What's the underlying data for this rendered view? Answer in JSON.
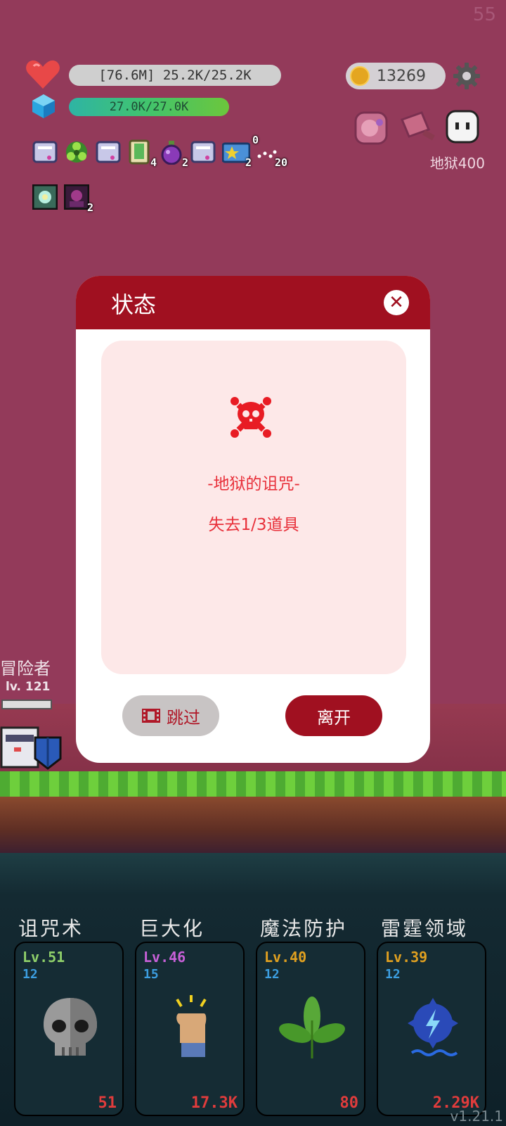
{
  "fps": "55",
  "hud": {
    "hp_text": "[76.6M] 25.2K/25.2K",
    "mp_text": "27.0K/27.0K",
    "coins": "13269",
    "hell_level": "地狱400"
  },
  "buffs_row1": [
    {
      "icon": "scroll-icon",
      "count": ""
    },
    {
      "icon": "biohazard-icon",
      "count": ""
    },
    {
      "icon": "scroll-icon",
      "count": ""
    },
    {
      "icon": "book-icon",
      "count": "4"
    },
    {
      "icon": "potion-icon",
      "count": "2"
    },
    {
      "icon": "scroll-icon",
      "count": ""
    },
    {
      "icon": "star-card-icon",
      "count": "2"
    }
  ],
  "buff_extra": {
    "top": "0",
    "bottom": "20"
  },
  "buffs_row2": [
    {
      "icon": "ghost-portrait-icon",
      "count": ""
    },
    {
      "icon": "demon-portrait-icon",
      "count": "2"
    }
  ],
  "modal": {
    "title": "状态",
    "curse_title": "-地狱的诅咒-",
    "curse_desc": "失去1/3道具",
    "skip_label": "跳过",
    "leave_label": "离开"
  },
  "adventurer": {
    "name": "冒险者",
    "level": "lv. 121"
  },
  "skills": [
    {
      "name": "诅咒术",
      "level": "Lv.51",
      "sub": "12",
      "cost": "51",
      "level_color": "#8fd06a",
      "icon": "skull-icon"
    },
    {
      "name": "巨大化",
      "level": "Lv.46",
      "sub": "15",
      "cost": "17.3K",
      "level_color": "#c860d8",
      "icon": "fist-icon"
    },
    {
      "name": "魔法防护",
      "level": "Lv.40",
      "sub": "12",
      "cost": "80",
      "level_color": "#e0a020",
      "icon": "leaf-icon"
    },
    {
      "name": "雷霆领域",
      "level": "Lv.39",
      "sub": "12",
      "cost": "2.29K",
      "level_color": "#e0a020",
      "icon": "thunder-orb-icon"
    }
  ],
  "version": "v1.21.1"
}
